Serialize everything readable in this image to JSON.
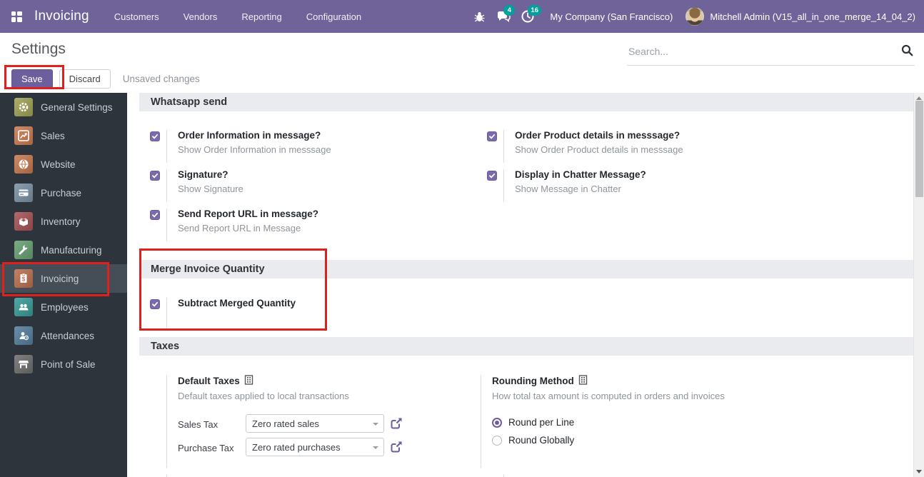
{
  "colors": {
    "navbar_purple": "#6f6399",
    "badge_teal": "#00a09d",
    "accent_purple": "#6d5d9c",
    "annotation_red": "#e0201d",
    "sidebar_dark": "#2e343c"
  },
  "navbar": {
    "app_name": "Invoicing",
    "menu": [
      "Customers",
      "Vendors",
      "Reporting",
      "Configuration"
    ],
    "message_badge": "4",
    "activity_badge": "16",
    "company": "My Company (San Francisco)",
    "user": "Mitchell Admin (V15_all_in_one_merge_14_04_2)"
  },
  "control_panel": {
    "title": "Settings",
    "save": "Save",
    "discard": "Discard",
    "status": "Unsaved changes",
    "search_placeholder": "Search..."
  },
  "sidebar": {
    "items": [
      {
        "label": "General Settings",
        "icon": "gear",
        "color": "#a2a457",
        "selected": false
      },
      {
        "label": "Sales",
        "icon": "chart",
        "color": "#cb7c52",
        "selected": false
      },
      {
        "label": "Website",
        "icon": "globe",
        "color": "#c87a4e",
        "selected": false
      },
      {
        "label": "Purchase",
        "icon": "credit-card",
        "color": "#7d93a5",
        "selected": false
      },
      {
        "label": "Inventory",
        "icon": "box",
        "color": "#a85456",
        "selected": false
      },
      {
        "label": "Manufacturing",
        "icon": "wrench",
        "color": "#69a273",
        "selected": false
      },
      {
        "label": "Invoicing",
        "icon": "invoice-document",
        "color": "#bd7150",
        "selected": true
      },
      {
        "label": "Employees",
        "icon": "people",
        "color": "#3a9d99",
        "selected": false
      },
      {
        "label": "Attendances",
        "icon": "person-clock",
        "color": "#56809f",
        "selected": false
      },
      {
        "label": "Point of Sale",
        "icon": "shop",
        "color": "#707070",
        "selected": false
      }
    ]
  },
  "sections": {
    "whatsapp": {
      "title": "Whatsapp send",
      "items": [
        {
          "label": "Order Information in message?",
          "help": "Show Order Information in messsage",
          "checked": true
        },
        {
          "label": "Order Product details in messsage?",
          "help": "Show Order Product details in messsage",
          "checked": true
        },
        {
          "label": "Signature?",
          "help": "Show Signature",
          "checked": true
        },
        {
          "label": "Display in Chatter Message?",
          "help": "Show Message in Chatter",
          "checked": true
        },
        {
          "label": "Send Report URL in message?",
          "help": "Send Report URL in Message",
          "checked": true
        }
      ]
    },
    "merge": {
      "title": "Merge Invoice Quantity",
      "items": [
        {
          "label": "Subtract Merged Quantity",
          "checked": true
        }
      ]
    },
    "taxes": {
      "title": "Taxes",
      "default_taxes": {
        "label": "Default Taxes",
        "help": "Default taxes applied to local transactions",
        "fields": [
          {
            "label": "Sales Tax",
            "value": "Zero rated sales"
          },
          {
            "label": "Purchase Tax",
            "value": "Zero rated purchases"
          }
        ]
      },
      "rounding": {
        "label": "Rounding Method",
        "help": "How total tax amount is computed in orders and invoices",
        "options": [
          {
            "label": "Round per Line",
            "selected": true
          },
          {
            "label": "Round Globally",
            "selected": false
          }
        ]
      }
    }
  }
}
